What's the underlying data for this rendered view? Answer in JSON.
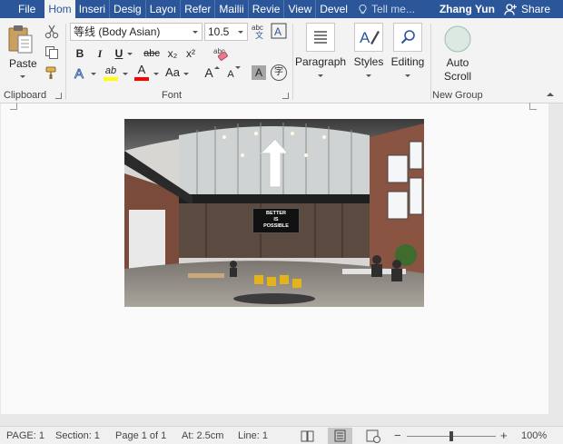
{
  "tabs": {
    "file": "File",
    "home": "Hom",
    "insert": "Inseri",
    "design": "Desig",
    "layout": "Layoı",
    "references": "Refer",
    "mailings": "Mailii",
    "review": "Revie",
    "view": "View",
    "developer": "Devel"
  },
  "tell_me": "Tell me...",
  "user_name": "Zhang Yun",
  "share_label": "Share",
  "clipboard": {
    "group_label": "Clipboard",
    "paste_label": "Paste"
  },
  "font": {
    "group_label": "Font",
    "font_name": "等线 (Body Asian)",
    "font_size": "10.5",
    "bold": "B",
    "italic": "I",
    "underline": "U",
    "strikethrough": "abc",
    "subscript": "x₂",
    "superscript": "x²",
    "grow": "A",
    "shrink": "A",
    "change_case": "Aa",
    "clear_format_text": "abc",
    "char_border": "A",
    "char_shading": "A",
    "enclose": "字",
    "text_effects": "A",
    "highlight": "ab",
    "font_color": "A",
    "highlight_color": "#ffff00",
    "font_color_value": "#ff0000"
  },
  "paragraph": {
    "label": "Paragraph"
  },
  "styles": {
    "label": "Styles"
  },
  "editing": {
    "label": "Editing"
  },
  "new_group": {
    "group_label": "New Group",
    "auto_scroll_line1": "Auto",
    "auto_scroll_line2": "Scroll"
  },
  "photo": {
    "sign_line1": "BETTER",
    "sign_line2": "IS",
    "sign_line3": "POSSIBLE"
  },
  "status": {
    "page": "PAGE: 1",
    "section": "Section: 1",
    "page_of": "Page 1 of 1",
    "at": "At: 2.5cm",
    "line": "Line: 1",
    "zoom_minus": "−",
    "zoom_plus": "+",
    "zoom": "100%",
    "zoom_level": 1.0
  },
  "colors": {
    "accent": "#2b579a",
    "ribbon_bg": "#f3f3f3",
    "page_bg": "#fafafa"
  }
}
